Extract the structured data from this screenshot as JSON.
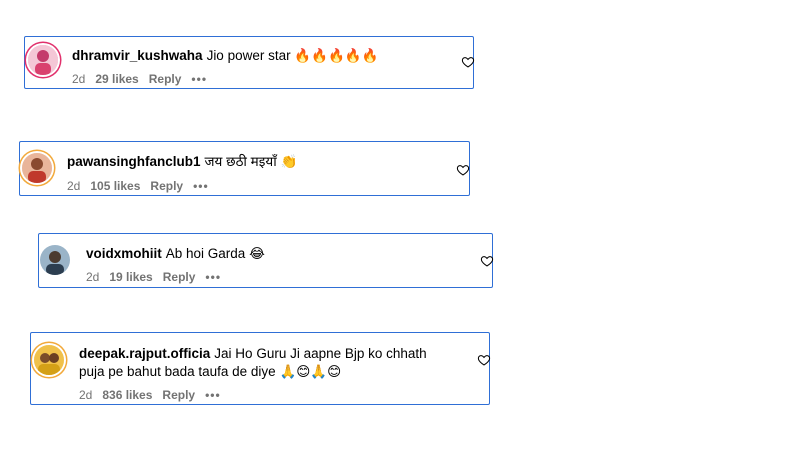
{
  "comments": [
    {
      "username": "dhramvir_kushwaha",
      "text": "Jio power star",
      "emoji": "🔥🔥🔥🔥🔥",
      "time": "2d",
      "likes": "29 likes",
      "reply": "Reply",
      "more": "•••"
    },
    {
      "username": "pawansinghfanclub1",
      "text": "जय छठी मइयाँ",
      "emoji": "👏",
      "time": "2d",
      "likes": "105 likes",
      "reply": "Reply",
      "more": "•••"
    },
    {
      "username": "voidxmohiit",
      "text": "Ab hoi Garda",
      "emoji": "😂",
      "time": "2d",
      "likes": "19 likes",
      "reply": "Reply",
      "more": "•••"
    },
    {
      "username": "deepak.rajput.officia",
      "text": "Jai Ho Guru Ji aapne Bjp ko chhath",
      "text2": "puja pe bahut bada taufa de diye",
      "emoji": "🙏😊🙏😊",
      "time": "2d",
      "likes": "836 likes",
      "reply": "Reply",
      "more": "•••"
    }
  ],
  "icons": {
    "like": "heart-outline-icon"
  },
  "colors": {
    "highlight_border": "#2f6fd6",
    "meta_text": "#737373",
    "story_ring": "#e1306c"
  }
}
